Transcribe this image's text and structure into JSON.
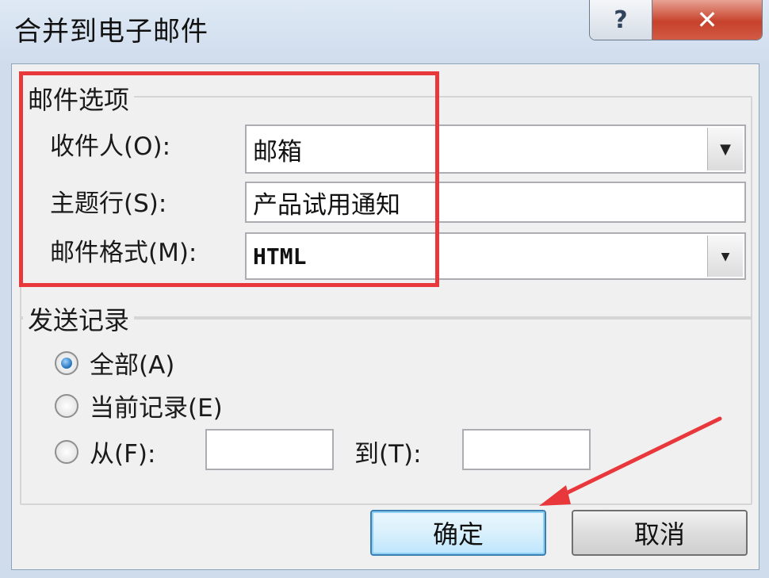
{
  "window": {
    "title": "合并到电子邮件",
    "help_glyph": "?",
    "close_glyph": "✕"
  },
  "mail_options": {
    "legend": "邮件选项",
    "to_label": "收件人(O):",
    "to_value": "邮箱",
    "subject_label": "主题行(S):",
    "subject_value": "产品试用通知",
    "format_label": "邮件格式(M):",
    "format_value": "HTML",
    "dropdown_glyph": "▼"
  },
  "send_records": {
    "legend": "发送记录",
    "all_label": "全部(A)",
    "current_label": "当前记录(E)",
    "from_label": "从(F):",
    "to_label": "到(T):",
    "from_value": "",
    "to_value": "",
    "selected": "all"
  },
  "buttons": {
    "ok": "确定",
    "cancel": "取消"
  },
  "colors": {
    "highlight": "#e8383c",
    "close_button": "#c7412b",
    "title_bar": "#cfdcec"
  }
}
